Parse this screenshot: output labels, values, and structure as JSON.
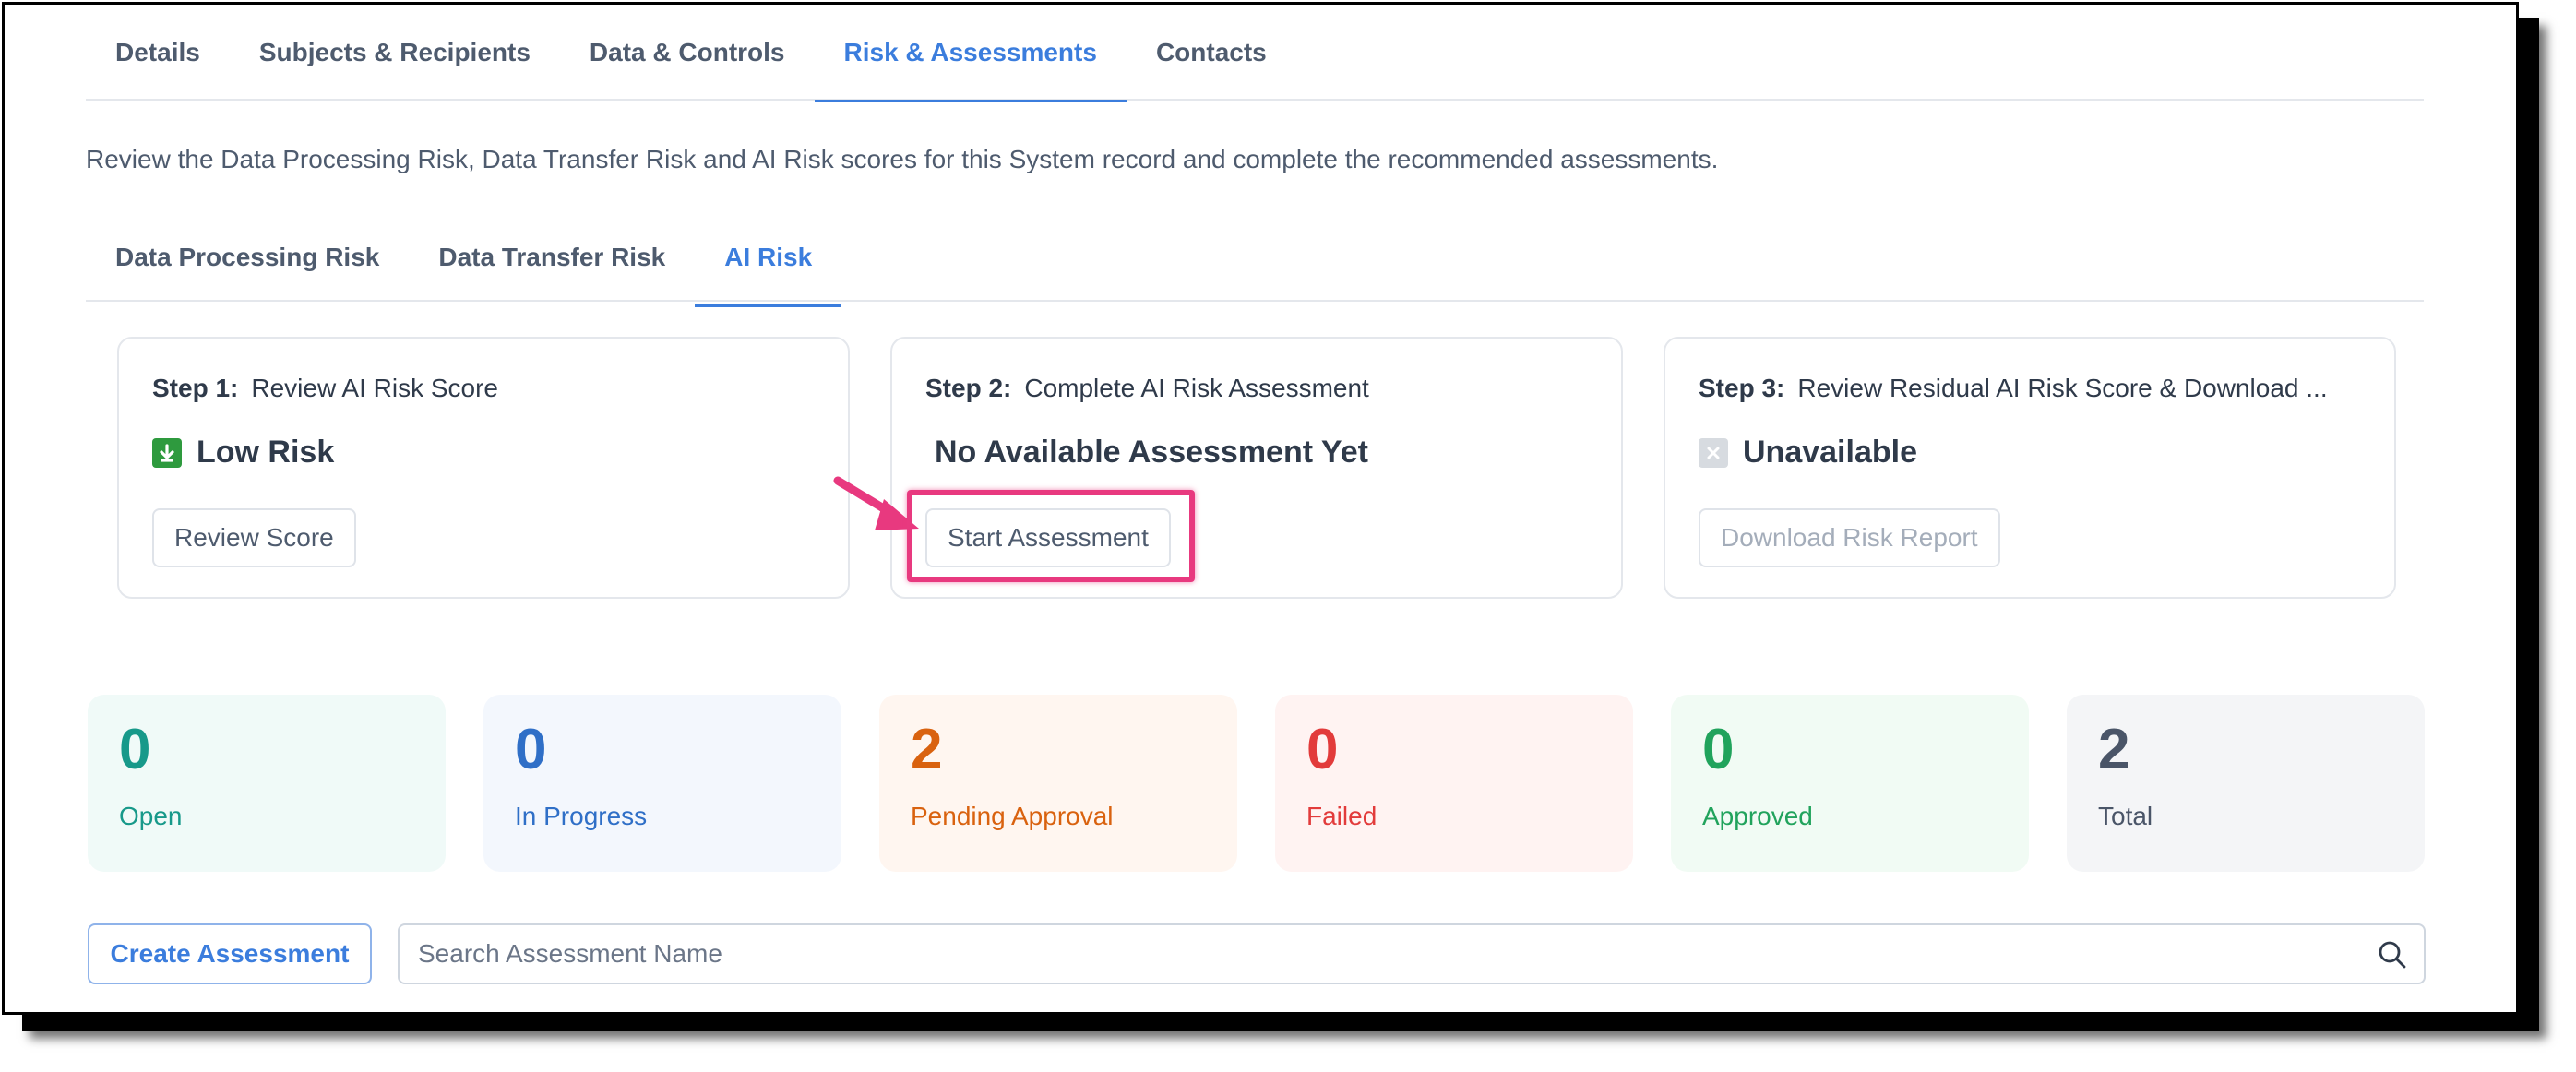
{
  "tabs": [
    {
      "label": "Details",
      "active": false
    },
    {
      "label": "Subjects & Recipients",
      "active": false
    },
    {
      "label": "Data & Controls",
      "active": false
    },
    {
      "label": "Risk & Assessments",
      "active": true
    },
    {
      "label": "Contacts",
      "active": false
    }
  ],
  "intro": "Review the Data Processing Risk, Data Transfer Risk and AI Risk scores for this System record and complete the recommended assessments.",
  "subtabs": [
    {
      "label": "Data Processing Risk",
      "active": false
    },
    {
      "label": "Data Transfer Risk",
      "active": false
    },
    {
      "label": "AI Risk",
      "active": true
    }
  ],
  "steps": [
    {
      "step": "Step 1:",
      "title": "Review AI Risk Score",
      "status": "Low Risk",
      "status_icon": "arrow-down-green-icon",
      "button": "Review Score",
      "button_enabled": true
    },
    {
      "step": "Step 2:",
      "title": "Complete AI Risk Assessment",
      "status": "No Available Assessment Yet",
      "status_icon": "",
      "button": "Start Assessment",
      "button_enabled": true
    },
    {
      "step": "Step 3:",
      "title": "Review Residual AI Risk Score & Download ...",
      "status": "Unavailable",
      "status_icon": "x-gray-icon",
      "button": "Download Risk Report",
      "button_enabled": false
    }
  ],
  "stats": [
    {
      "value": "0",
      "label": "Open",
      "color": "#17998a",
      "bg": "#f0faf8"
    },
    {
      "value": "0",
      "label": "In Progress",
      "color": "#2f6fc7",
      "bg": "#f3f7fd"
    },
    {
      "value": "2",
      "label": "Pending Approval",
      "color": "#d9620f",
      "bg": "#fff6f0"
    },
    {
      "value": "0",
      "label": "Failed",
      "color": "#e23b3b",
      "bg": "#fff3f2"
    },
    {
      "value": "0",
      "label": "Approved",
      "color": "#21a35c",
      "bg": "#f1fbf4"
    },
    {
      "value": "2",
      "label": "Total",
      "color": "#4a5568",
      "bg": "#f4f5f7"
    }
  ],
  "toolbar": {
    "create_label": "Create Assessment",
    "search_placeholder": "Search Assessment Name"
  },
  "annotation": {
    "color": "#e8397f"
  },
  "colors": {
    "accent": "#3b7ddd"
  }
}
